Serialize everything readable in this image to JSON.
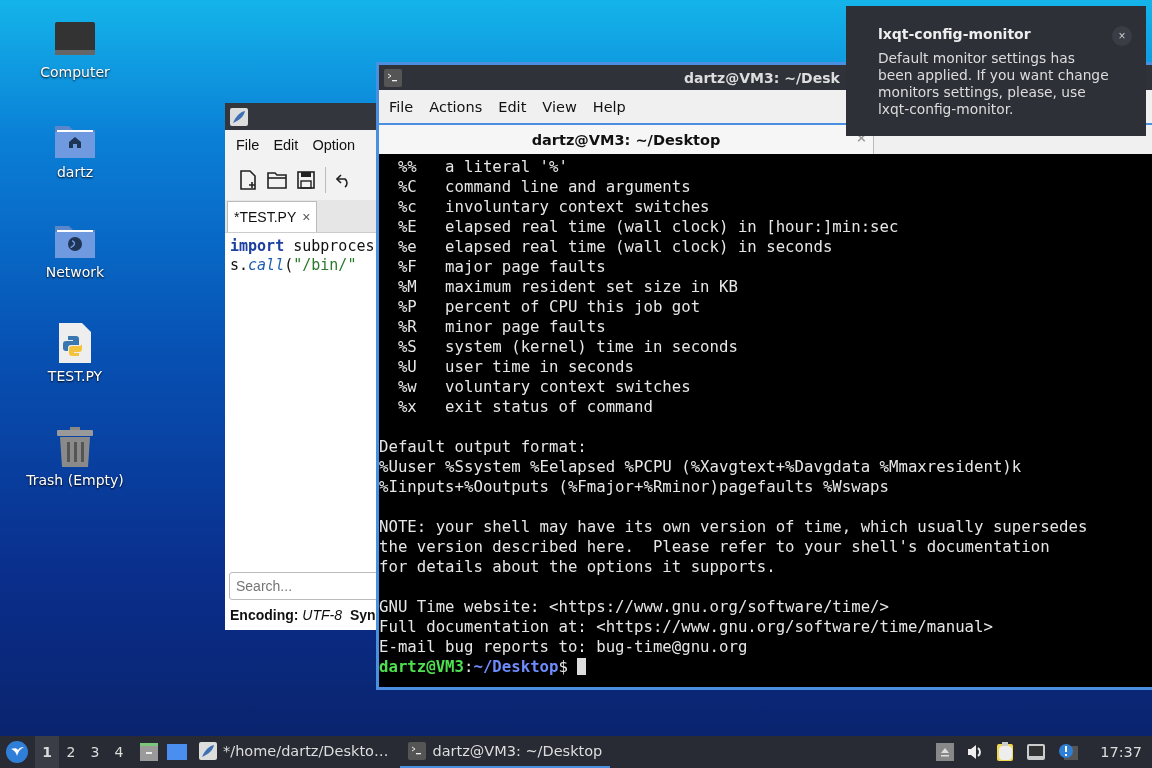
{
  "desktop_icons": [
    {
      "label": "Computer",
      "kind": "computer"
    },
    {
      "label": "dartz",
      "kind": "home"
    },
    {
      "label": "Network",
      "kind": "network"
    },
    {
      "label": "TEST.PY",
      "kind": "python"
    },
    {
      "label": "Trash (Empty)",
      "kind": "trash"
    }
  ],
  "editor": {
    "menu": [
      "File",
      "Edit",
      "Option"
    ],
    "tab": {
      "label": "*TEST.PY",
      "close": "×",
      "selected": true
    },
    "code": [
      [
        {
          "text": "import",
          "kind": "keyword"
        },
        {
          "text": " subproces",
          "kind": "plain"
        }
      ],
      [
        {
          "text": "s.",
          "kind": "plain"
        },
        {
          "text": "call",
          "kind": "function"
        },
        {
          "text": "(",
          "kind": "plain"
        },
        {
          "text": "\"/bin/\"",
          "kind": "string"
        }
      ]
    ],
    "search": {
      "placeholder": "Search..."
    },
    "status": [
      {
        "label": "Encoding:",
        "value": "UTF-8"
      },
      {
        "label": "Syn"
      }
    ]
  },
  "terminal": {
    "title": "dartz@VM3: ~/Desk",
    "menu": [
      "File",
      "Actions",
      "Edit",
      "View",
      "Help"
    ],
    "tab": {
      "label": "dartz@VM3: ~/Desktop",
      "close": "×",
      "selected": true
    },
    "lines": [
      {
        "kind": "text",
        "text": "  %%   a literal '%'"
      },
      {
        "kind": "text",
        "text": "  %C   command line and arguments"
      },
      {
        "kind": "text",
        "text": "  %c   involuntary context switches"
      },
      {
        "kind": "text",
        "text": "  %E   elapsed real time (wall clock) in [hour:]min:sec"
      },
      {
        "kind": "text",
        "text": "  %e   elapsed real time (wall clock) in seconds"
      },
      {
        "kind": "text",
        "text": "  %F   major page faults"
      },
      {
        "kind": "text",
        "text": "  %M   maximum resident set size in KB"
      },
      {
        "kind": "text",
        "text": "  %P   percent of CPU this job got"
      },
      {
        "kind": "text",
        "text": "  %R   minor page faults"
      },
      {
        "kind": "text",
        "text": "  %S   system (kernel) time in seconds"
      },
      {
        "kind": "text",
        "text": "  %U   user time in seconds"
      },
      {
        "kind": "text",
        "text": "  %w   voluntary context switches"
      },
      {
        "kind": "text",
        "text": "  %x   exit status of command"
      },
      {
        "kind": "blank"
      },
      {
        "kind": "text",
        "text": "Default output format:"
      },
      {
        "kind": "text",
        "text": "%Uuser %Ssystem %Eelapsed %PCPU (%Xavgtext+%Davgdata %Mmaxresident)k"
      },
      {
        "kind": "text",
        "text": "%Iinputs+%Ooutputs (%Fmajor+%Rminor)pagefaults %Wswaps"
      },
      {
        "kind": "blank"
      },
      {
        "kind": "text",
        "text": "NOTE: your shell may have its own version of time, which usually supersedes"
      },
      {
        "kind": "text",
        "text": "the version described here.  Please refer to your shell's documentation"
      },
      {
        "kind": "text",
        "text": "for details about the options it supports."
      },
      {
        "kind": "blank"
      },
      {
        "kind": "text",
        "text": "GNU Time website: <https://www.gnu.org/software/time/>"
      },
      {
        "kind": "text",
        "text": "Full documentation at: <https://www.gnu.org/software/time/manual>"
      },
      {
        "kind": "text",
        "text": "E-mail bug reports to: bug-time@gnu.org"
      },
      {
        "kind": "prompt",
        "user": "dartz@VM3",
        "sep": ":",
        "path": "~/Desktop",
        "symbol": "$"
      }
    ]
  },
  "notification": {
    "title": "lxqt-config-monitor",
    "body": "Default monitor settings has been applied. If you want change monitors settings, please, use lxqt-config-monitor.",
    "close": "×"
  },
  "taskbar": {
    "desktops": [
      {
        "label": "1",
        "selected": true
      },
      {
        "label": "2",
        "selected": false
      },
      {
        "label": "3",
        "selected": false
      },
      {
        "label": "4",
        "selected": false
      }
    ],
    "tasks": [
      {
        "label": "*/home/dartz/Deskto…",
        "kind": "editor",
        "selected": false
      },
      {
        "label": "dartz@VM3: ~/Desktop",
        "kind": "terminal",
        "selected": true
      }
    ],
    "clock": "17:37"
  }
}
